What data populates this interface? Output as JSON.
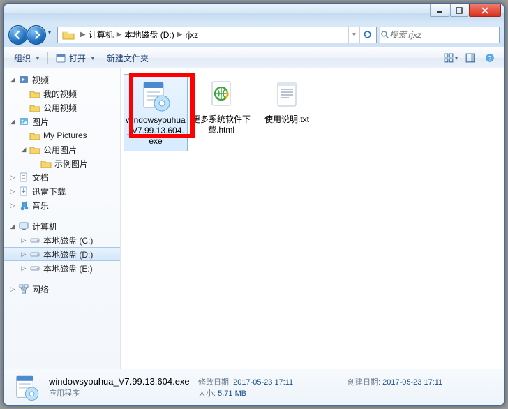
{
  "titlebar": {},
  "nav": {
    "crumbs": [
      "计算机",
      "本地磁盘 (D:)",
      "rjxz"
    ],
    "search_placeholder": "搜索 rjxz"
  },
  "toolbar": {
    "organize": "组织",
    "open": "打开",
    "new_folder": "新建文件夹"
  },
  "sidebar": {
    "videos": "视频",
    "my_videos": "我的视频",
    "public_videos": "公用视频",
    "pictures": "图片",
    "my_pictures": "My Pictures",
    "public_pictures": "公用图片",
    "sample_pictures": "示例图片",
    "documents": "文档",
    "xunlei": "迅雷下载",
    "music": "音乐",
    "computer": "计算机",
    "drive_c": "本地磁盘 (C:)",
    "drive_d": "本地磁盘 (D:)",
    "drive_e": "本地磁盘 (E:)",
    "network": "网络"
  },
  "files": [
    {
      "name": "windowsyouhua_V7.99.13.604.exe",
      "label_lines": "windowsyouhua_V7.99.13.604.exe",
      "type": "exe",
      "selected": true
    },
    {
      "name": "更多系统软件下载.html",
      "label_lines": "更多系统软件下载.html",
      "type": "html",
      "selected": false
    },
    {
      "name": "使用说明.txt",
      "label_lines": "使用说明.txt",
      "type": "txt",
      "selected": false
    }
  ],
  "details": {
    "filename": "windowsyouhua_V7.99.13.604.exe",
    "filetype": "应用程序",
    "mod_label": "修改日期:",
    "mod_value": "2017-05-23 17:11",
    "size_label": "大小:",
    "size_value": "5.71 MB",
    "created_label": "创建日期:",
    "created_value": "2017-05-23 17:11"
  }
}
